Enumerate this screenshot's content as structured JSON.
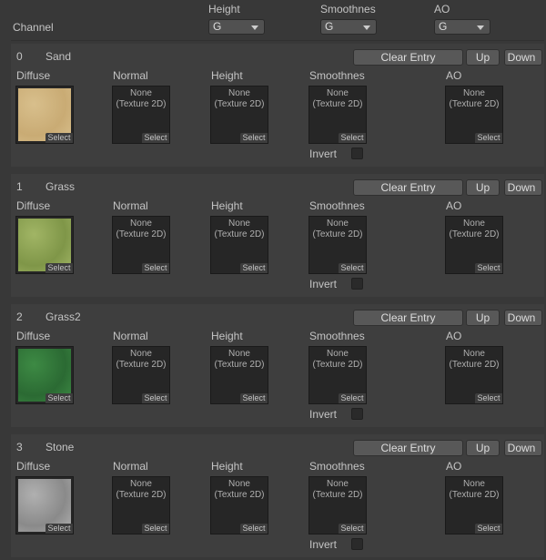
{
  "channel": {
    "label": "Channel",
    "columns": [
      {
        "label": "Height",
        "value": "G"
      },
      {
        "label": "Smoothnes",
        "value": "G"
      },
      {
        "label": "AO",
        "value": "G"
      }
    ]
  },
  "buttons": {
    "clear": "Clear Entry",
    "up": "Up",
    "down": "Down"
  },
  "slots": {
    "diffuse": "Diffuse",
    "normal": "Normal",
    "height": "Height",
    "smoothness": "Smoothnes",
    "ao": "AO",
    "none1": "None",
    "none2": "(Texture 2D)",
    "select": "Select",
    "invert": "Invert"
  },
  "entries": [
    {
      "index": "0",
      "name": "Sand",
      "color": "#d8bf8c",
      "color2": "#c9ab74"
    },
    {
      "index": "1",
      "name": "Grass",
      "color": "#a1b565",
      "color2": "#7f9648"
    },
    {
      "index": "2",
      "name": "Grass2",
      "color": "#3d8a44",
      "color2": "#2b6a33"
    },
    {
      "index": "3",
      "name": "Stone",
      "color": "#b0b0b0",
      "color2": "#8a8a8a"
    }
  ]
}
